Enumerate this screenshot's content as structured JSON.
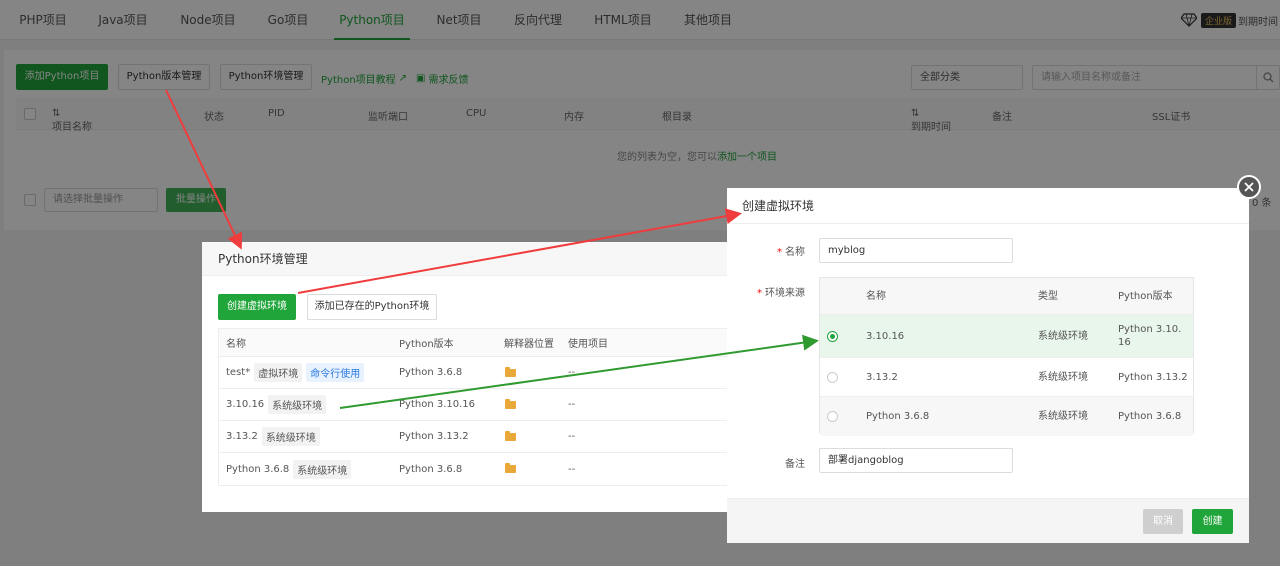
{
  "nav": {
    "tabs": [
      "PHP项目",
      "Java项目",
      "Node项目",
      "Go项目",
      "Python项目",
      "Net项目",
      "反向代理",
      "HTML项目",
      "其他项目"
    ],
    "active": "Python项目",
    "vip_badge": "企业版",
    "expire_text": "到期时间"
  },
  "toolbar": {
    "add_python": "添加Python项目",
    "version_mgmt": "Python版本管理",
    "env_mgmt": "Python环境管理",
    "tutorial": "Python项目教程",
    "feedback": "需求反馈",
    "category": "全部分类",
    "search_placeholder": "请输入项目名称或备注"
  },
  "project_table": {
    "headers": [
      "项目名称",
      "状态",
      "PID",
      "监听端口",
      "CPU",
      "内存",
      "根目录",
      "到期时间",
      "备注",
      "SSL证书"
    ],
    "empty_text": "您的列表为空，您可以",
    "empty_link": "添加一个项目",
    "batch_placeholder": "请选择批量操作",
    "batch_button": "批量操作",
    "count_text": "0 条"
  },
  "env_dialog": {
    "title": "Python环境管理",
    "create_btn": "创建虚拟环境",
    "add_existing_btn": "添加已存在的Python环境",
    "headers": [
      "名称",
      "Python版本",
      "解释器位置",
      "使用项目"
    ],
    "rows": [
      {
        "name": "test*",
        "tags": [
          "虚拟环境",
          "命令行使用"
        ],
        "version": "Python 3.6.8",
        "used": "--"
      },
      {
        "name": "3.10.16",
        "tags": [
          "系统级环境"
        ],
        "version": "Python 3.10.16",
        "used": "--"
      },
      {
        "name": "3.13.2",
        "tags": [
          "系统级环境"
        ],
        "version": "Python 3.13.2",
        "used": "--"
      },
      {
        "name": "Python 3.6.8",
        "tags": [
          "系统级环境"
        ],
        "version": "Python 3.6.8",
        "used": "--"
      }
    ]
  },
  "create_dialog": {
    "title": "创建虚拟环境",
    "name_label": "名称",
    "name_value": "myblog",
    "source_label": "环境来源",
    "source_headers": [
      "名称",
      "类型",
      "Python版本"
    ],
    "source_rows": [
      {
        "name": "3.10.16",
        "type": "系统级环境",
        "version": "Python 3.10.16",
        "selected": true
      },
      {
        "name": "3.13.2",
        "type": "系统级环境",
        "version": "Python 3.13.2",
        "selected": false
      },
      {
        "name": "Python 3.6.8",
        "type": "系统级环境",
        "version": "Python 3.6.8",
        "selected": false
      }
    ],
    "remark_label": "备注",
    "remark_value": "部署djangoblog",
    "cancel": "取消",
    "create": "创建"
  },
  "colors": {
    "accent_green": "#20a53a",
    "annotation_red": "#f03c3c",
    "annotation_green": "#2f9a2f"
  }
}
